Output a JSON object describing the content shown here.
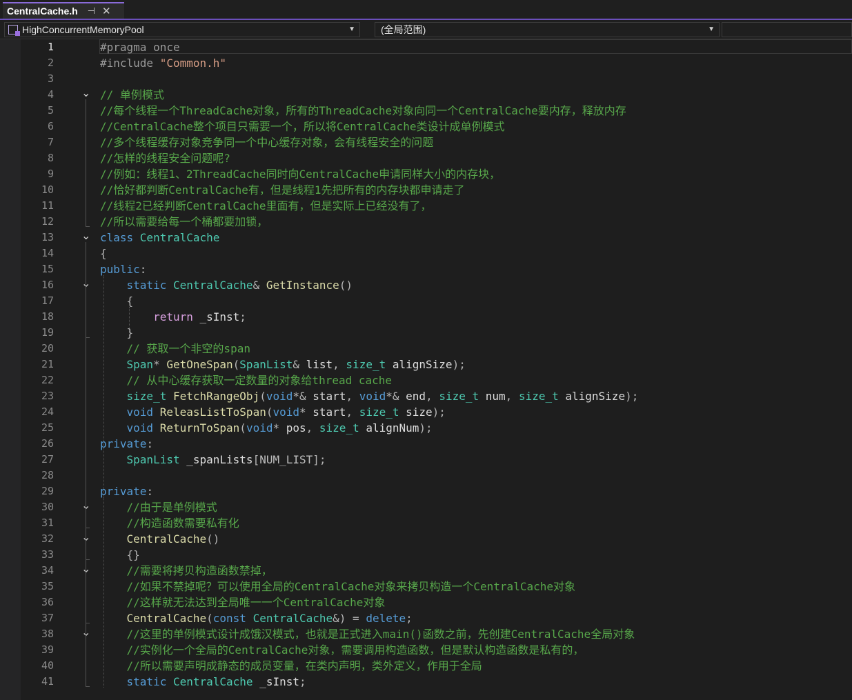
{
  "tab": {
    "title": "CentralCache.h",
    "pin_icon": "pin-icon",
    "close_icon": "close-icon"
  },
  "navbar": {
    "project": "HighConcurrentMemoryPool",
    "scope": "(全局范围)"
  },
  "editor": {
    "current_line": 1,
    "line_numbers": [
      "1",
      "2",
      "3",
      "4",
      "5",
      "6",
      "7",
      "8",
      "9",
      "10",
      "11",
      "12",
      "13",
      "14",
      "15",
      "16",
      "17",
      "18",
      "19",
      "20",
      "21",
      "22",
      "23",
      "24",
      "25",
      "26",
      "27",
      "28",
      "29",
      "30",
      "31",
      "32",
      "33",
      "34",
      "35",
      "36",
      "37",
      "38",
      "39",
      "40",
      "41"
    ],
    "lines": [
      [
        [
          "pp",
          "#pragma once"
        ]
      ],
      [
        [
          "pp",
          "#include "
        ],
        [
          "str",
          "\"Common.h\""
        ]
      ],
      [],
      [
        [
          "cm",
          "// 单例模式"
        ]
      ],
      [
        [
          "cm",
          "//每个线程一个ThreadCache对象，所有的ThreadCache对象向同一个CentralCache要内存，释放内存"
        ]
      ],
      [
        [
          "cm",
          "//CentralCache整个项目只需要一个，所以将CentralCache类设计成单例模式"
        ]
      ],
      [
        [
          "cm",
          "//多个线程缓存对象竞争同一个中心缓存对象，会有线程安全的问题"
        ]
      ],
      [
        [
          "cm",
          "//怎样的线程安全问题呢?"
        ]
      ],
      [
        [
          "cm",
          "//例如：线程1、2ThreadCache同时向CentralCache申请同样大小的内存块，"
        ]
      ],
      [
        [
          "cm",
          "//恰好都判断CentralCache有，但是线程1先把所有的内存块都申请走了"
        ]
      ],
      [
        [
          "cm",
          "//线程2已经判断CentralCache里面有，但是实际上已经没有了，"
        ]
      ],
      [
        [
          "cm",
          "//所以需要给每一个桶都要加锁，"
        ]
      ],
      [
        [
          "kw",
          "class "
        ],
        [
          "type",
          "CentralCache"
        ]
      ],
      [
        [
          "pun",
          "{"
        ]
      ],
      [
        [
          "kw",
          "public"
        ],
        [
          "pun",
          ":"
        ]
      ],
      [
        [
          "pun",
          "    "
        ],
        [
          "kw",
          "static "
        ],
        [
          "type",
          "CentralCache"
        ],
        [
          "pun",
          "& "
        ],
        [
          "fn",
          "GetInstance"
        ],
        [
          "pun",
          "()"
        ]
      ],
      [
        [
          "pun",
          "    {"
        ]
      ],
      [
        [
          "pun",
          "        "
        ],
        [
          "ctl",
          "return "
        ],
        [
          "var",
          "_sInst"
        ],
        [
          "pun",
          ";"
        ]
      ],
      [
        [
          "pun",
          "    }"
        ]
      ],
      [
        [
          "pun",
          "    "
        ],
        [
          "cm",
          "// 获取一个非空的span"
        ]
      ],
      [
        [
          "pun",
          "    "
        ],
        [
          "type",
          "Span"
        ],
        [
          "pun",
          "* "
        ],
        [
          "fn",
          "GetOneSpan"
        ],
        [
          "pun",
          "("
        ],
        [
          "type",
          "SpanList"
        ],
        [
          "pun",
          "& "
        ],
        [
          "var",
          "list"
        ],
        [
          "pun",
          ", "
        ],
        [
          "type",
          "size_t"
        ],
        [
          "pun",
          " "
        ],
        [
          "var",
          "alignSize"
        ],
        [
          "pun",
          ");"
        ]
      ],
      [
        [
          "pun",
          "    "
        ],
        [
          "cm",
          "// 从中心缓存获取一定数量的对象给thread cache"
        ]
      ],
      [
        [
          "pun",
          "    "
        ],
        [
          "type",
          "size_t "
        ],
        [
          "fn",
          "FetchRangeObj"
        ],
        [
          "pun",
          "("
        ],
        [
          "kw",
          "void"
        ],
        [
          "pun",
          "*& "
        ],
        [
          "var",
          "start"
        ],
        [
          "pun",
          ", "
        ],
        [
          "kw",
          "void"
        ],
        [
          "pun",
          "*& "
        ],
        [
          "var",
          "end"
        ],
        [
          "pun",
          ", "
        ],
        [
          "type",
          "size_t"
        ],
        [
          "pun",
          " "
        ],
        [
          "var",
          "num"
        ],
        [
          "pun",
          ", "
        ],
        [
          "type",
          "size_t"
        ],
        [
          "pun",
          " "
        ],
        [
          "var",
          "alignSize"
        ],
        [
          "pun",
          ");"
        ]
      ],
      [
        [
          "pun",
          "    "
        ],
        [
          "kw",
          "void "
        ],
        [
          "fn",
          "ReleasListToSpan"
        ],
        [
          "pun",
          "("
        ],
        [
          "kw",
          "void"
        ],
        [
          "pun",
          "* "
        ],
        [
          "var",
          "start"
        ],
        [
          "pun",
          ", "
        ],
        [
          "type",
          "size_t"
        ],
        [
          "pun",
          " "
        ],
        [
          "var",
          "size"
        ],
        [
          "pun",
          ");"
        ]
      ],
      [
        [
          "pun",
          "    "
        ],
        [
          "kw",
          "void "
        ],
        [
          "fn",
          "ReturnToSpan"
        ],
        [
          "pun",
          "("
        ],
        [
          "kw",
          "void"
        ],
        [
          "pun",
          "* "
        ],
        [
          "var",
          "pos"
        ],
        [
          "pun",
          ", "
        ],
        [
          "type",
          "size_t"
        ],
        [
          "pun",
          " "
        ],
        [
          "var",
          "alignNum"
        ],
        [
          "pun",
          ");"
        ]
      ],
      [
        [
          "kw",
          "private"
        ],
        [
          "pun",
          ":"
        ]
      ],
      [
        [
          "pun",
          "    "
        ],
        [
          "type",
          "SpanList "
        ],
        [
          "var",
          "_spanLists"
        ],
        [
          "pun",
          "["
        ],
        [
          "mac",
          "NUM_LIST"
        ],
        [
          "pun",
          "];"
        ]
      ],
      [],
      [
        [
          "kw",
          "private"
        ],
        [
          "pun",
          ":"
        ]
      ],
      [
        [
          "pun",
          "    "
        ],
        [
          "cm",
          "//由于是单例模式"
        ]
      ],
      [
        [
          "pun",
          "    "
        ],
        [
          "cm",
          "//构造函数需要私有化"
        ]
      ],
      [
        [
          "pun",
          "    "
        ],
        [
          "fn",
          "CentralCache"
        ],
        [
          "pun",
          "()"
        ]
      ],
      [
        [
          "pun",
          "    {}"
        ]
      ],
      [
        [
          "pun",
          "    "
        ],
        [
          "cm",
          "//需要将拷贝构造函数禁掉，"
        ]
      ],
      [
        [
          "pun",
          "    "
        ],
        [
          "cm",
          "//如果不禁掉呢？可以使用全局的CentralCache对象来拷贝构造一个CentralCache对象"
        ]
      ],
      [
        [
          "pun",
          "    "
        ],
        [
          "cm",
          "//这样就无法达到全局唯一一个CentralCache对象"
        ]
      ],
      [
        [
          "pun",
          "    "
        ],
        [
          "fn",
          "CentralCache"
        ],
        [
          "pun",
          "("
        ],
        [
          "kw",
          "const "
        ],
        [
          "type",
          "CentralCache"
        ],
        [
          "pun",
          "&) = "
        ],
        [
          "kw",
          "delete"
        ],
        [
          "pun",
          ";"
        ]
      ],
      [
        [
          "pun",
          "    "
        ],
        [
          "cm",
          "//这里的单例模式设计成饿汉模式，也就是正式进入main()函数之前，先创建CentralCache全局对象"
        ]
      ],
      [
        [
          "pun",
          "    "
        ],
        [
          "cm",
          "//实例化一个全局的CentralCache对象，需要调用构造函数，但是默认构造函数是私有的，"
        ]
      ],
      [
        [
          "pun",
          "    "
        ],
        [
          "cm",
          "//所以需要声明成静态的成员变量，在类内声明，类外定义，作用于全局"
        ]
      ],
      [
        [
          "pun",
          "    "
        ],
        [
          "kw",
          "static "
        ],
        [
          "type",
          "CentralCache "
        ],
        [
          "var",
          "_sInst"
        ],
        [
          "pun",
          ";"
        ]
      ]
    ],
    "fold_lines": [
      4,
      13,
      16,
      30,
      32,
      34,
      38
    ]
  },
  "colors": {
    "background": "#1e1e1e",
    "comment": "#57a64a",
    "keyword": "#569cd6",
    "type": "#4ec9b0",
    "function": "#dcdcaa",
    "string": "#d69d85",
    "accent": "#6b4fbb"
  }
}
